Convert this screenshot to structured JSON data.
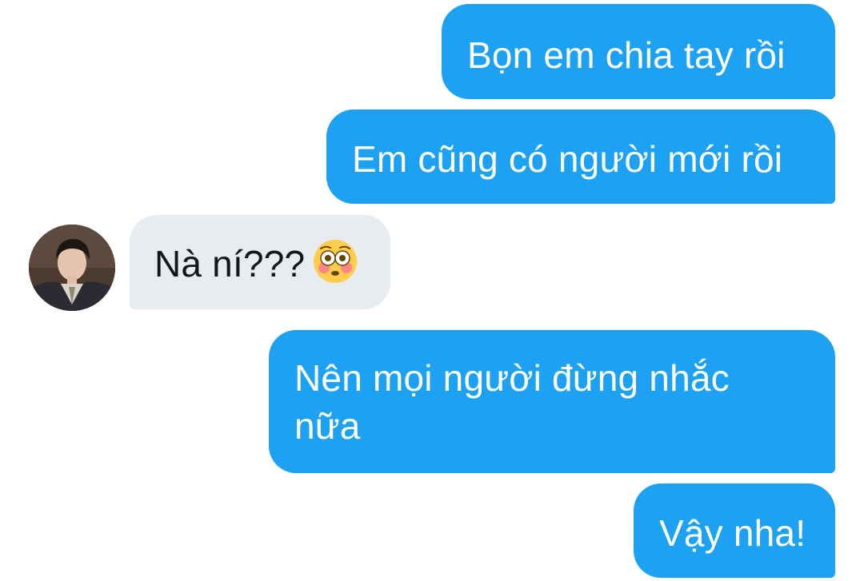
{
  "conversation": {
    "messages": [
      {
        "direction": "outgoing",
        "text": "Bọn em chia tay rồi"
      },
      {
        "direction": "outgoing",
        "text": "Em cũng có người mới rồi"
      },
      {
        "direction": "incoming",
        "text": "Nà ní???",
        "emoji": "flushed-face-emoji"
      },
      {
        "direction": "outgoing",
        "text": "Nên mọi người đừng nhắc nữa"
      },
      {
        "direction": "outgoing",
        "text": "Vậy nha!"
      }
    ],
    "colors": {
      "outgoing_bubble": "#1da1f2",
      "incoming_bubble": "#e6ecf0",
      "outgoing_text": "#ffffff",
      "incoming_text": "#14171a"
    },
    "contact": {
      "avatar_icon": "contact-avatar-photo"
    }
  }
}
